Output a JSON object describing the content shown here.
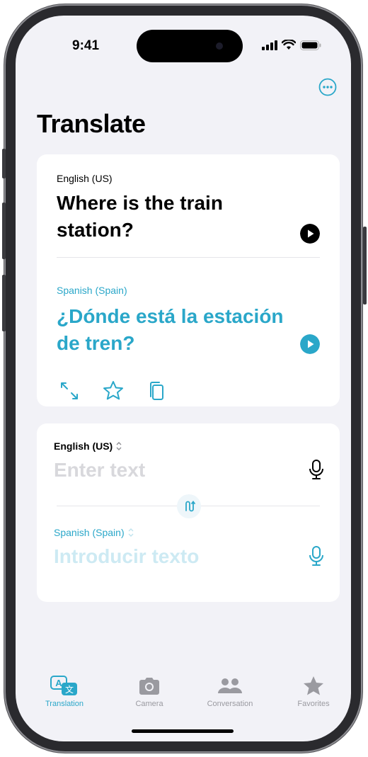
{
  "status_bar": {
    "time": "9:41"
  },
  "header": {
    "title": "Translate",
    "more_icon": "ellipsis-circle-icon"
  },
  "translation_card": {
    "source_language": "English (US)",
    "source_text": "Where is the train station?",
    "target_language": "Spanish (Spain)",
    "target_text": "¿Dónde está la estación de tren?",
    "actions": [
      "expand-icon",
      "favorite-star-icon",
      "copy-icon"
    ]
  },
  "input_card": {
    "top_language": "English (US)",
    "top_placeholder": "Enter text",
    "bottom_language": "Spanish (Spain)",
    "bottom_placeholder": "Introducir texto"
  },
  "tab_bar": {
    "tabs": [
      {
        "label": "Translation",
        "icon": "translate-icon",
        "active": true
      },
      {
        "label": "Camera",
        "icon": "camera-icon",
        "active": false
      },
      {
        "label": "Conversation",
        "icon": "people-icon",
        "active": false
      },
      {
        "label": "Favorites",
        "icon": "star-icon",
        "active": false
      }
    ]
  },
  "colors": {
    "accent": "#2aa7c9",
    "background": "#f2f2f7",
    "card": "#ffffff",
    "inactive": "#9a9aa0"
  }
}
